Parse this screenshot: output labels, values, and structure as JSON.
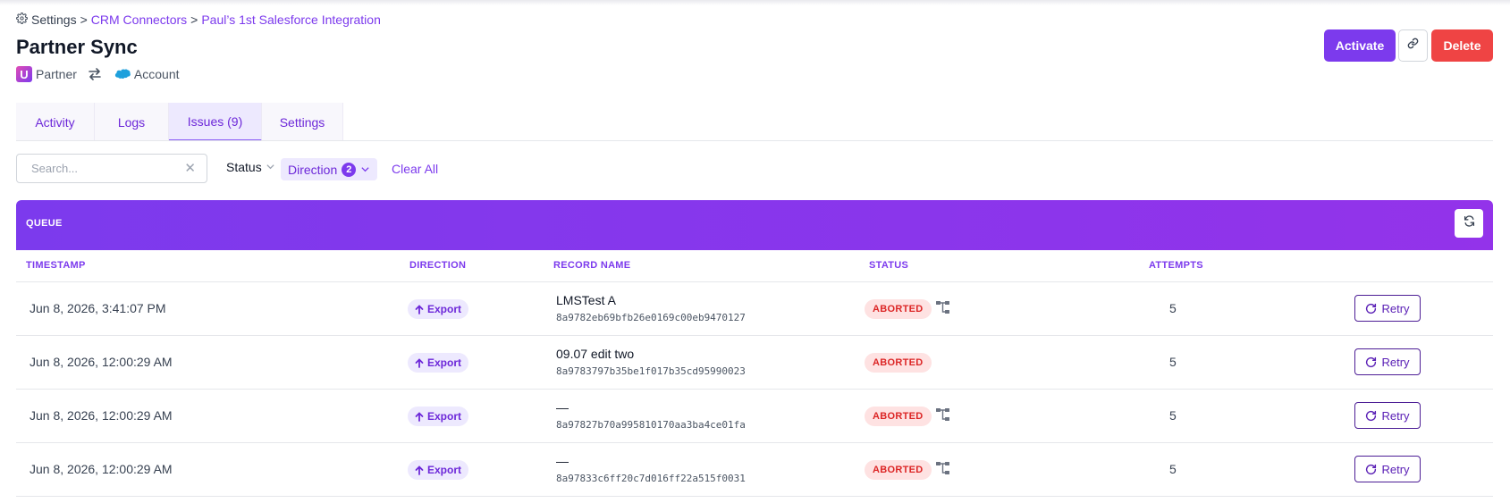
{
  "breadcrumb": {
    "settings": "Settings",
    "sep1": ">",
    "crm": "CRM Connectors",
    "sep2": ">",
    "integration": "Paul’s 1st Salesforce Integration"
  },
  "page": {
    "title": "Partner Sync",
    "source_logo_letter": "U",
    "source": "Partner",
    "target": "Account"
  },
  "actions": {
    "activate": "Activate",
    "delete": "Delete"
  },
  "tabs": [
    {
      "label": "Activity",
      "active": false
    },
    {
      "label": "Logs",
      "active": false
    },
    {
      "label": "Issues (9)",
      "active": true
    },
    {
      "label": "Settings",
      "active": false
    }
  ],
  "filters": {
    "search_placeholder": "Search...",
    "search_value": "",
    "clear_symbol": "✕",
    "status_label": "Status",
    "direction_label": "Direction",
    "direction_count": "2",
    "clear_all": "Clear All"
  },
  "queue": {
    "label": "QUEUE",
    "columns": [
      "TIMESTAMP",
      "DIRECTION",
      "RECORD NAME",
      "STATUS",
      "ATTEMPTS"
    ],
    "rows": [
      {
        "timestamp": "Jun 8, 2026, 3:41:07 PM",
        "direction": "Export",
        "name": "LMSTest A",
        "id": "8a9782eb69bfb26e0169c00eb9470127",
        "status": "ABORTED",
        "has_tree_icon": true,
        "attempts": "5",
        "action": "Retry"
      },
      {
        "timestamp": "Jun 8, 2026, 12:00:29 AM",
        "direction": "Export",
        "name": "09.07 edit two",
        "id": "8a9783797b35be1f017b35cd95990023",
        "status": "ABORTED",
        "has_tree_icon": false,
        "attempts": "5",
        "action": "Retry"
      },
      {
        "timestamp": "Jun 8, 2026, 12:00:29 AM",
        "direction": "Export",
        "name": "—",
        "id": "8a97827b70a995810170aa3ba4ce01fa",
        "status": "ABORTED",
        "has_tree_icon": true,
        "attempts": "5",
        "action": "Retry"
      },
      {
        "timestamp": "Jun 8, 2026, 12:00:29 AM",
        "direction": "Export",
        "name": "—",
        "id": "8a97833c6ff20c7d016ff22a515f0031",
        "status": "ABORTED",
        "has_tree_icon": true,
        "attempts": "5",
        "action": "Retry"
      }
    ]
  },
  "colors": {
    "accent": "#7c3aed",
    "danger": "#ef4444",
    "aborted_bg": "#fee2e2",
    "aborted_text": "#dc2626"
  },
  "icons": {
    "settings": "gear-icon",
    "link": "link-icon",
    "swap": "swap-arrows-icon",
    "salesforce": "salesforce-cloud-icon",
    "refresh": "refresh-icon",
    "export": "arrow-up-icon",
    "tree": "hierarchy-icon",
    "retry": "retry-icon"
  }
}
